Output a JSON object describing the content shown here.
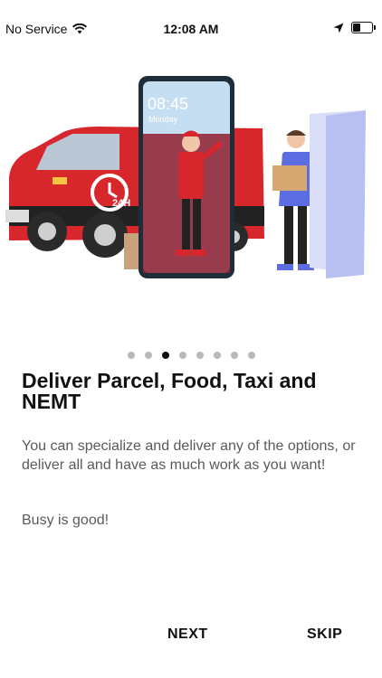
{
  "status_bar": {
    "carrier": "No Service",
    "time": "12:08 AM",
    "icons": [
      "wifi-icon",
      "location-arrow-icon",
      "battery-icon"
    ]
  },
  "illustration": {
    "phone_time": "08:45",
    "phone_day": "Monday",
    "badge_text": "24H"
  },
  "pagination": {
    "total": 8,
    "active_index": 2
  },
  "onboarding": {
    "title": "Deliver Parcel, Food, Taxi and NEMT",
    "description": "You can specialize and deliver any of the options, or deliver all and have as much work as you want!",
    "tagline": "Busy is good!"
  },
  "actions": {
    "next_label": "NEXT",
    "skip_label": "SKIP"
  },
  "colors": {
    "van_red": "#d7262c",
    "accent_blue": "#5b6de0",
    "active_dot": "#111111",
    "inactive_dot": "#b9b9b9",
    "body_text": "#5a5a5a"
  }
}
